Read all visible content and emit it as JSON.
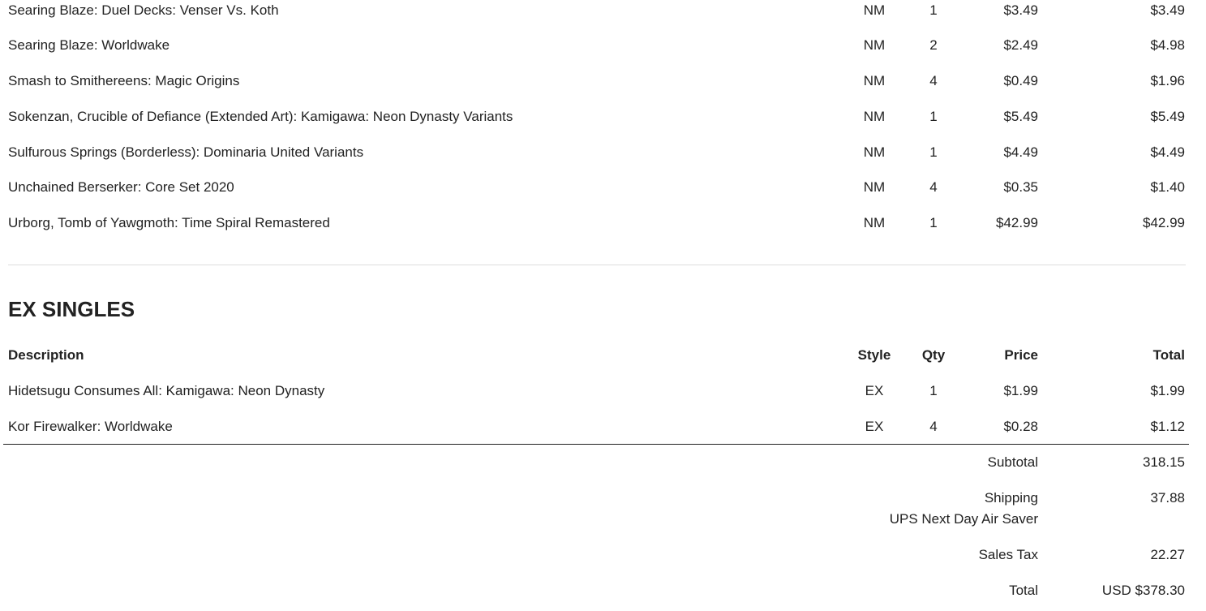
{
  "nm_rows": [
    {
      "description": "Searing Blaze: Duel Decks: Venser Vs. Koth",
      "style": "NM",
      "qty": "1",
      "price": "$3.49",
      "total": "$3.49"
    },
    {
      "description": "Searing Blaze: Worldwake",
      "style": "NM",
      "qty": "2",
      "price": "$2.49",
      "total": "$4.98"
    },
    {
      "description": "Smash to Smithereens: Magic Origins",
      "style": "NM",
      "qty": "4",
      "price": "$0.49",
      "total": "$1.96"
    },
    {
      "description": "Sokenzan, Crucible of Defiance (Extended Art): Kamigawa: Neon Dynasty Variants",
      "style": "NM",
      "qty": "1",
      "price": "$5.49",
      "total": "$5.49"
    },
    {
      "description": "Sulfurous Springs (Borderless): Dominaria United Variants",
      "style": "NM",
      "qty": "1",
      "price": "$4.49",
      "total": "$4.49"
    },
    {
      "description": "Unchained Berserker: Core Set 2020",
      "style": "NM",
      "qty": "4",
      "price": "$0.35",
      "total": "$1.40"
    },
    {
      "description": "Urborg, Tomb of Yawgmoth: Time Spiral Remastered",
      "style": "NM",
      "qty": "1",
      "price": "$42.99",
      "total": "$42.99"
    }
  ],
  "ex_section": {
    "title": "EX SINGLES",
    "headers": {
      "description": "Description",
      "style": "Style",
      "qty": "Qty",
      "price": "Price",
      "total": "Total"
    },
    "rows": [
      {
        "description": "Hidetsugu Consumes All: Kamigawa: Neon Dynasty",
        "style": "EX",
        "qty": "1",
        "price": "$1.99",
        "total": "$1.99"
      },
      {
        "description": "Kor Firewalker: Worldwake",
        "style": "EX",
        "qty": "4",
        "price": "$0.28",
        "total": "$1.12"
      }
    ]
  },
  "summary": {
    "subtotal_label": "Subtotal",
    "subtotal_value": "318.15",
    "shipping_label": "Shipping",
    "shipping_method": "UPS Next Day Air Saver",
    "shipping_value": "37.88",
    "tax_label": "Sales Tax",
    "tax_value": "22.27",
    "total_label": "Total",
    "total_value": "USD $378.30"
  },
  "colors": {
    "text": "#222222",
    "divider": "#dddddd",
    "rule": "#222222"
  }
}
